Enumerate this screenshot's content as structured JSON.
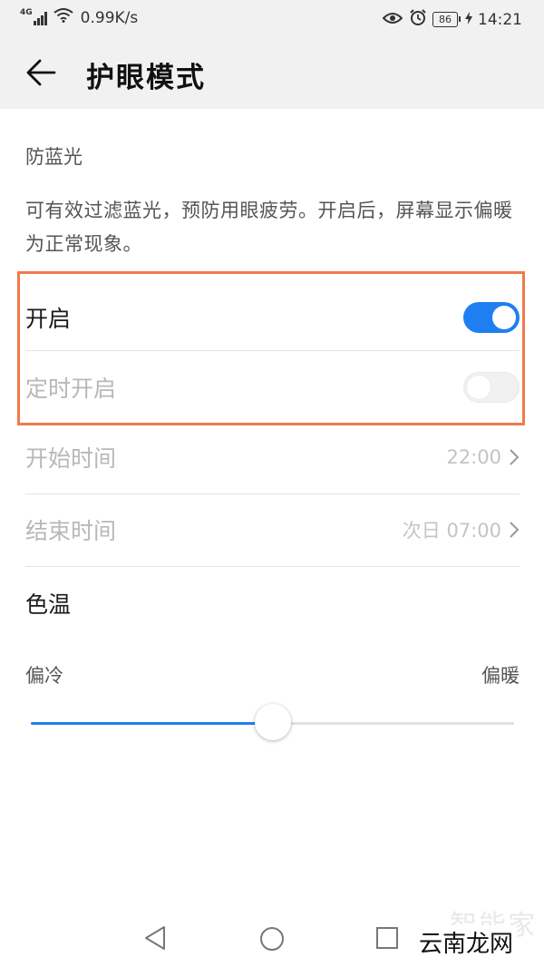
{
  "status_bar": {
    "network_type": "4G",
    "speed": "0.99K/s",
    "battery": "86",
    "time": "14:21"
  },
  "header": {
    "title": "护眼模式"
  },
  "blue_light": {
    "section_title": "防蓝光",
    "description": "可有效过滤蓝光，预防用眼疲劳。开启后，屏幕显示偏暖为正常现象。",
    "enable_label": "开启",
    "enable_state": true,
    "schedule_label": "定时开启",
    "schedule_state": false,
    "start_time_label": "开始时间",
    "start_time_value": "22:00",
    "end_time_label": "结束时间",
    "end_time_value": "次日 07:00"
  },
  "color_temperature": {
    "title": "色温",
    "cool_label": "偏冷",
    "warm_label": "偏暖",
    "value_fraction": 0.5
  },
  "watermark": {
    "ghost_text": "智能家",
    "text": "云南龙网"
  },
  "colors": {
    "accent": "#1f7ff0",
    "highlight": "#f07a4a"
  }
}
